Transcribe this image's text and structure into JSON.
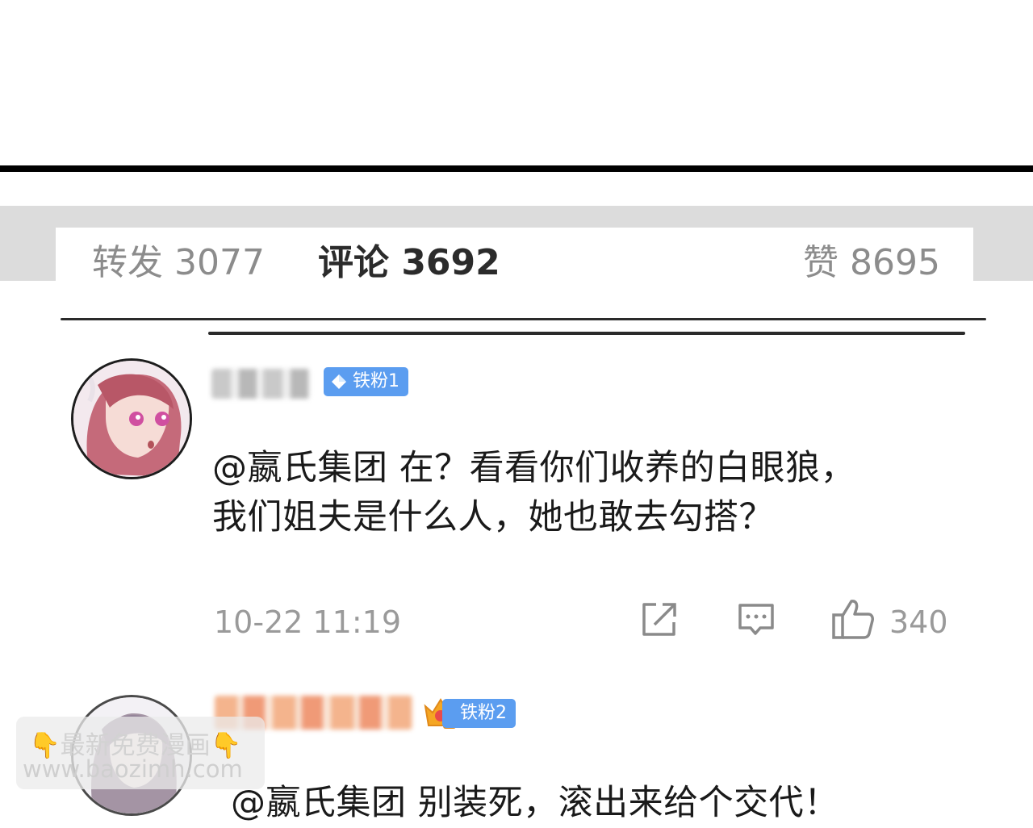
{
  "tabs": {
    "repost": "转发 3077",
    "comment": "评论 3692",
    "like": "赞 8695"
  },
  "comments": [
    {
      "badge": "铁粉1",
      "text_line1": "@嬴氏集团 在？看看你们收养的白眼狼，",
      "text_line2": "我们姐夫是什么人，她也敢去勾搭？",
      "timestamp": "10-22 11:19",
      "like_count": "340",
      "badge_color": "#5b9df0"
    },
    {
      "badge": "铁粉2",
      "text": "@嬴氏集团 别装死，滚出来给个交代！",
      "badge_color": "#5b9df0"
    }
  ],
  "watermark": {
    "line1": "最新免费漫画",
    "line2": "www.baozimh.com",
    "hand_icon": "👇"
  },
  "icons": [
    "share-icon",
    "reply-icon",
    "thumbs-up-icon",
    "diamond-icon",
    "crown-icon"
  ]
}
